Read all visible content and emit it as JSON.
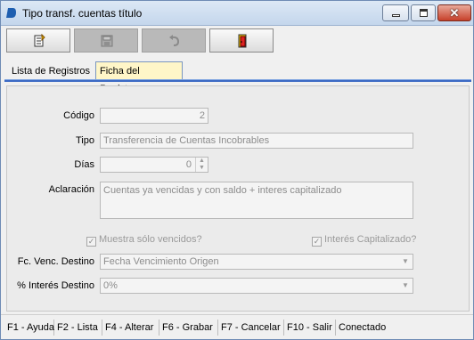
{
  "window": {
    "title": "Tipo transf. cuentas título"
  },
  "toolbar": {
    "buttons": [
      {
        "icon": "new-record-icon",
        "enabled": true
      },
      {
        "icon": "save-disk-icon",
        "enabled": false
      },
      {
        "icon": "undo-icon",
        "enabled": false
      },
      {
        "icon": "exit-door-icon",
        "enabled": true
      }
    ]
  },
  "tabs": [
    {
      "label": "Lista de Registros",
      "active": false
    },
    {
      "label": "Ficha del Registro",
      "active": true
    }
  ],
  "form": {
    "codigo": {
      "label": "Código",
      "value": "2"
    },
    "tipo": {
      "label": "Tipo",
      "value": "Transferencia de Cuentas Incobrables"
    },
    "dias": {
      "label": "Días",
      "value": "0"
    },
    "aclaracion": {
      "label": "Aclaración",
      "value": "Cuentas ya vencidas y con saldo + interes capitalizado"
    },
    "muestra_vencidos": {
      "label": "Muestra sólo vencidos?",
      "checked": true
    },
    "interes_capitalizado": {
      "label": "Interés Capitalizado?",
      "checked": true
    },
    "fc_venc_destino": {
      "label": "Fc. Venc. Destino",
      "value": "Fecha Vencimiento Origen"
    },
    "interes_destino": {
      "label": "% Interés Destino",
      "value": "0%"
    }
  },
  "statusbar": {
    "items": [
      "F1 - Ayuda",
      "F2 - Lista",
      "F4 - Alterar",
      "F6 - Grabar",
      "F7 - Cancelar",
      "F10 - Salir",
      "Conectado"
    ]
  },
  "colors": {
    "tab_active_bg": "#fff6c8",
    "tab_line": "#3c6ac4",
    "close_button": "#c7402a"
  }
}
